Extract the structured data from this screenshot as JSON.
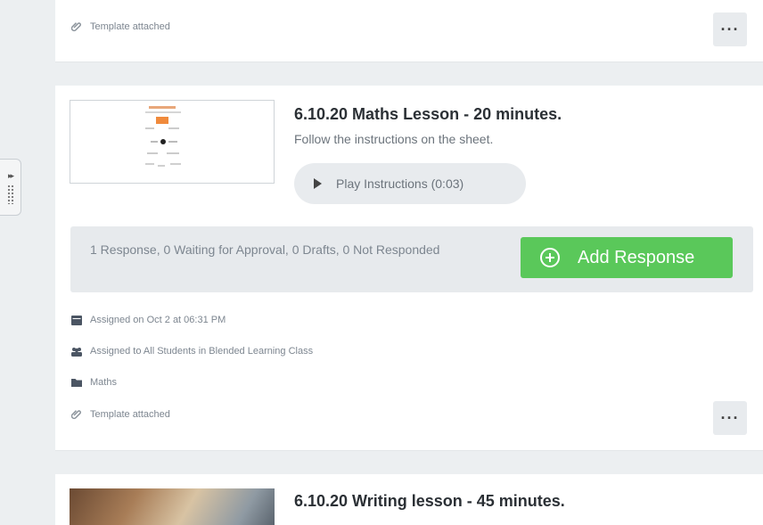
{
  "top_card": {
    "attachment": "Template attached",
    "more": "···"
  },
  "lesson": {
    "title": "6.10.20 Maths Lesson - 20 minutes.",
    "description": "Follow the instructions on the sheet.",
    "play_label": "Play Instructions (0:03)",
    "response_summary": "1 Response, 0 Waiting for Approval, 0 Drafts, 0 Not Responded",
    "add_response_label": "Add Response",
    "assigned_on": "Assigned on Oct 2 at 06:31 PM",
    "assigned_to": "Assigned to All Students in Blended Learning Class",
    "folder": "Maths",
    "attachment": "Template attached",
    "more": "···",
    "accent_color": "#5ac85a"
  },
  "next_lesson": {
    "title": "6.10.20 Writing lesson - 45 minutes."
  }
}
